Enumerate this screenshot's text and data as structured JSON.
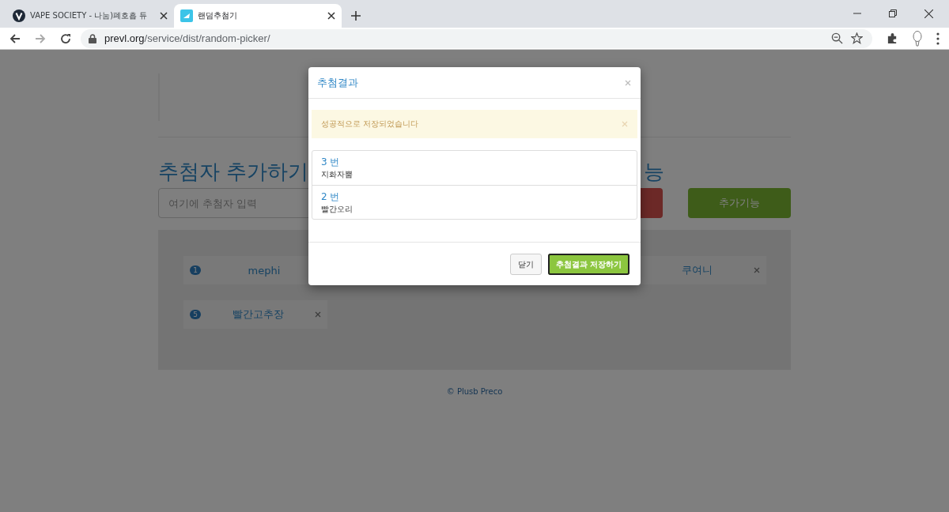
{
  "browser": {
    "tabs": [
      {
        "title": "VAPE SOCIETY - 나눔)폐호흡 듀",
        "selected": false
      },
      {
        "title": "랜덤추첨기",
        "selected": true
      }
    ],
    "url_host": "prevl.org",
    "url_path": "/service/dist/random-picker/"
  },
  "page": {
    "heading_left": "추첨자 추가하기",
    "heading_right": "능",
    "input": {
      "placeholder": "여기에 추첨자 입력"
    },
    "buttons": [
      {
        "kind": "danger"
      },
      {
        "kind": "success",
        "label": "추가기능"
      }
    ],
    "chips": [
      {
        "number": "1",
        "name": "mephi",
        "removable": false
      },
      {
        "name": "쿠여니",
        "removable": true
      },
      {
        "number": "5",
        "name": "빨간고추장",
        "removable": true
      }
    ],
    "footer": "© Plusb Preco"
  },
  "modal": {
    "title": "추첨결과",
    "alert": "성공적으로 저장되었습니다",
    "results": [
      {
        "number": "3 번",
        "name": "지화자뿜"
      },
      {
        "number": "2 번",
        "name": "빨간오리"
      }
    ],
    "buttons": [
      {
        "label": "닫기",
        "kind": "default",
        "focused": false
      },
      {
        "label": "추첨결과 저장하기",
        "kind": "success",
        "focused": true
      }
    ]
  }
}
